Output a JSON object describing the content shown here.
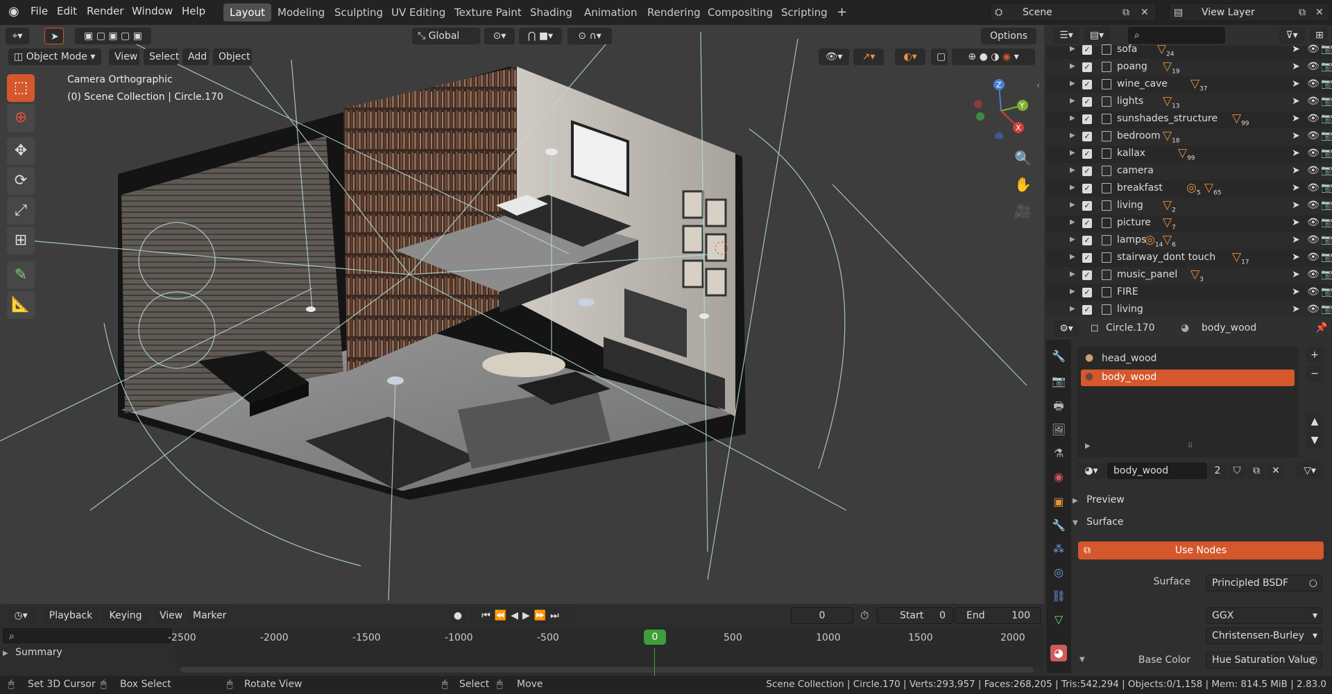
{
  "topbar": {
    "menus": [
      "File",
      "Edit",
      "Render",
      "Window",
      "Help"
    ],
    "workspaces": [
      "Layout",
      "Modeling",
      "Sculpting",
      "UV Editing",
      "Texture Paint",
      "Shading",
      "Animation",
      "Rendering",
      "Compositing",
      "Scripting"
    ],
    "active_workspace": "Layout",
    "add_tab": "+",
    "scene_label": "Scene",
    "view_layer_label": "View Layer"
  },
  "viewport_header": {
    "transform_orientation": "Global",
    "options": "Options",
    "mode": "Object Mode",
    "menus": [
      "View",
      "Select",
      "Add",
      "Object"
    ]
  },
  "viewport": {
    "view_name": "Camera Orthographic",
    "collection_info": "(0) Scene Collection | Circle.170"
  },
  "outliner": {
    "rows": [
      {
        "name": "sofa",
        "badge": "24"
      },
      {
        "name": "poang",
        "badge": "19"
      },
      {
        "name": "wine_cave",
        "badge": "37"
      },
      {
        "name": "lights",
        "badge": "13"
      },
      {
        "name": "sunshades_structure",
        "badge": "99"
      },
      {
        "name": "bedroom",
        "badge": "18"
      },
      {
        "name": "kallax",
        "badge": "99"
      },
      {
        "name": "camera",
        "badge": ""
      },
      {
        "name": "breakfast",
        "badge": "65",
        "badge2": "5"
      },
      {
        "name": "living",
        "badge": "2"
      },
      {
        "name": "picture",
        "badge": "7"
      },
      {
        "name": "lamps",
        "badge": "6",
        "badge2": "14"
      },
      {
        "name": "stairway_dont touch",
        "badge": "17"
      },
      {
        "name": "music_panel",
        "badge": "3"
      },
      {
        "name": "FIRE",
        "badge": ""
      },
      {
        "name": "living",
        "badge": ""
      }
    ]
  },
  "properties": {
    "object_name": "Circle.170",
    "material_name": "body_wood",
    "slots": [
      "head_wood",
      "body_wood"
    ],
    "active_slot": "body_wood",
    "datablock_name": "body_wood",
    "users": "2",
    "preview_label": "Preview",
    "surface_panel_label": "Surface",
    "use_nodes": "Use Nodes",
    "surface_label": "Surface",
    "surface_value": "Principled BSDF",
    "distribution": "GGX",
    "subsurface": "Christensen-Burley",
    "base_color_label": "Base Color",
    "base_color_value": "Hue Saturation Value"
  },
  "timeline": {
    "menus": [
      "Playback",
      "Keying",
      "View",
      "Marker"
    ],
    "current_frame": "0",
    "start_label": "Start",
    "start": "0",
    "end_label": "End",
    "end": "100",
    "ticks": [
      "-2500",
      "-2000",
      "-1500",
      "-1000",
      "-500",
      "0",
      "500",
      "1000",
      "1500",
      "2000"
    ],
    "summary": "Summary"
  },
  "statusbar": {
    "set_cursor": "Set 3D Cursor",
    "box_select": "Box Select",
    "rotate_view": "Rotate View",
    "select": "Select",
    "move": "Move",
    "stats": "Scene Collection | Circle.170 | Verts:293,957 | Faces:268,205 | Tris:542,294 | Objects:0/1,158 | Mem: 814.5 MiB | 2.83.0"
  },
  "colors": {
    "accent": "#d5572c",
    "badge": "#e8913a",
    "playhead": "#3e9e3a"
  }
}
